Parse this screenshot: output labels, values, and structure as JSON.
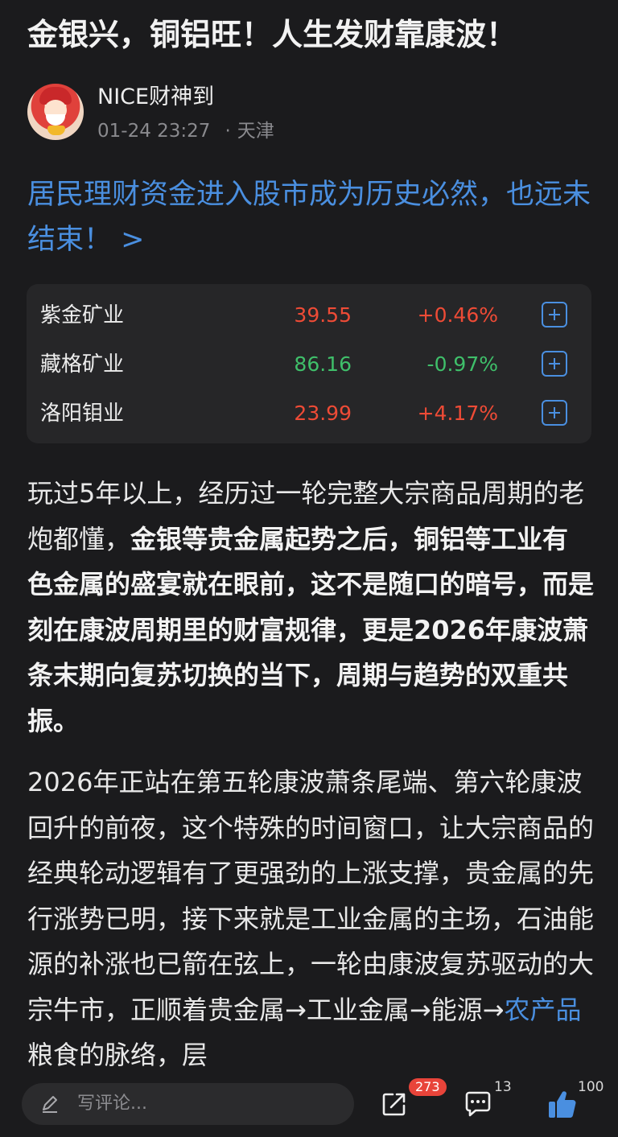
{
  "article": {
    "title": "金银兴，铜铝旺！人生发财靠康波！"
  },
  "author": {
    "name": "NICE财神到",
    "time": "01-24 23:27",
    "location": "天津",
    "separator": "·"
  },
  "topic_link": {
    "text": "居民理财资金进入股市成为历史必然，也远未结束！ >"
  },
  "stocks": [
    {
      "name": "紫金矿业",
      "price": "39.55",
      "change": "+0.46%",
      "direction": "up"
    },
    {
      "name": "藏格矿业",
      "price": "86.16",
      "change": "-0.97%",
      "direction": "down"
    },
    {
      "name": "洛阳钼业",
      "price": "23.99",
      "change": "+4.17%",
      "direction": "up"
    }
  ],
  "colors": {
    "up": "#ee4b36",
    "down": "#3fbf6a",
    "accent": "#4a8fe0",
    "background": "#1b1b1d"
  },
  "body": {
    "p1_a": "玩过5年以上，经历过一轮完整大宗商品周期的老炮都懂，",
    "p1_b": "金银等贵金属起势之后，铜铝等工业有色金属的盛宴就在眼前，这不是随口的暗号，而是刻在康波周期里的财富规律，更是2026年康波萧条末期向复苏切换的当下，周期与趋势的双重共振。",
    "p2_a": "2026年正站在第五轮康波萧条尾端、第六轮康波回升的前夜，这个特殊的时间窗口，让大宗商品的经典轮动逻辑有了更强劲的上涨支撑，贵金属的先行涨势已明，接下来就是工业金属的主场，石油能源的补涨也已箭在弦上，一轮由康波复苏驱动的大宗牛市，正顺着贵金属→工业金属→能源→",
    "p2_link": "农产品",
    "p2_b": "粮食的脉络，层"
  },
  "bottom_bar": {
    "comment_placeholder": "写评论...",
    "share_count": "273",
    "comment_count": "13",
    "like_count": "100",
    "icons": [
      "pen-icon",
      "share-icon",
      "comment-icon",
      "thumbs-up-icon"
    ]
  }
}
